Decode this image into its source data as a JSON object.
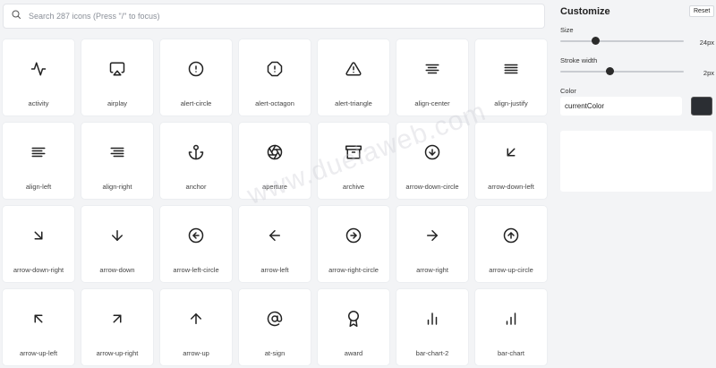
{
  "search": {
    "placeholder": "Search 287 icons (Press \"/\" to focus)",
    "value": ""
  },
  "icons": [
    {
      "label": "activity",
      "icon": "activity-icon"
    },
    {
      "label": "airplay",
      "icon": "airplay-icon"
    },
    {
      "label": "alert-circle",
      "icon": "alert-circle-icon"
    },
    {
      "label": "alert-octagon",
      "icon": "alert-octagon-icon"
    },
    {
      "label": "alert-triangle",
      "icon": "alert-triangle-icon"
    },
    {
      "label": "align-center",
      "icon": "align-center-icon"
    },
    {
      "label": "align-justify",
      "icon": "align-justify-icon"
    },
    {
      "label": "align-left",
      "icon": "align-left-icon"
    },
    {
      "label": "align-right",
      "icon": "align-right-icon"
    },
    {
      "label": "anchor",
      "icon": "anchor-icon"
    },
    {
      "label": "aperture",
      "icon": "aperture-icon"
    },
    {
      "label": "archive",
      "icon": "archive-icon"
    },
    {
      "label": "arrow-down-circle",
      "icon": "arrow-down-circle-icon"
    },
    {
      "label": "arrow-down-left",
      "icon": "arrow-down-left-icon"
    },
    {
      "label": "arrow-down-right",
      "icon": "arrow-down-right-icon"
    },
    {
      "label": "arrow-down",
      "icon": "arrow-down-icon"
    },
    {
      "label": "arrow-left-circle",
      "icon": "arrow-left-circle-icon"
    },
    {
      "label": "arrow-left",
      "icon": "arrow-left-icon"
    },
    {
      "label": "arrow-right-circle",
      "icon": "arrow-right-circle-icon"
    },
    {
      "label": "arrow-right",
      "icon": "arrow-right-icon"
    },
    {
      "label": "arrow-up-circle",
      "icon": "arrow-up-circle-icon"
    },
    {
      "label": "arrow-up-left",
      "icon": "arrow-up-left-icon"
    },
    {
      "label": "arrow-up-right",
      "icon": "arrow-up-right-icon"
    },
    {
      "label": "arrow-up",
      "icon": "arrow-up-icon"
    },
    {
      "label": "at-sign",
      "icon": "at-sign-icon"
    },
    {
      "label": "award",
      "icon": "award-icon"
    },
    {
      "label": "bar-chart-2",
      "icon": "bar-chart-2-icon"
    },
    {
      "label": "bar-chart",
      "icon": "bar-chart-icon"
    }
  ],
  "panel": {
    "title": "Customize",
    "reset_label": "Reset",
    "size": {
      "label": "Size",
      "value_text": "24px",
      "fraction": 0.28
    },
    "stroke": {
      "label": "Stroke width",
      "value_text": "2px",
      "fraction": 0.4
    },
    "color": {
      "label": "Color",
      "value": "currentColor",
      "swatch": "#2b2e33"
    }
  },
  "watermark": "www.duelaweb.com"
}
